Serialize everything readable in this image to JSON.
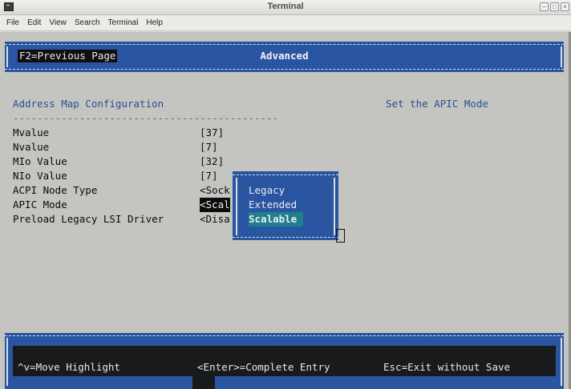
{
  "window": {
    "title": "Terminal",
    "controls": [
      "minimize",
      "maximize",
      "close"
    ]
  },
  "menubar": {
    "items": [
      "File",
      "Edit",
      "View",
      "Search",
      "Terminal",
      "Help"
    ]
  },
  "bios": {
    "header": {
      "f2_label": "F2=Previous Page",
      "title": "Advanced"
    },
    "section_title": "Address Map Configuration",
    "separator": "--------------------------------------------",
    "help_text": "Set the APIC Mode",
    "settings": [
      {
        "name": "Mvalue",
        "value": "[37]"
      },
      {
        "name": "Nvalue",
        "value": "[7]"
      },
      {
        "name": "MIo Value",
        "value": "[32]"
      },
      {
        "name": "NIo Value",
        "value": "[7]"
      },
      {
        "name": "ACPI Node Type",
        "value": "<Sock"
      },
      {
        "name": "APIC Mode",
        "value": "<Scal"
      },
      {
        "name": "Preload Legacy LSI Driver",
        "value": "<Disa"
      }
    ],
    "popup": {
      "options": [
        "Legacy",
        "Extended",
        "Scalable"
      ],
      "selected": "Scalable"
    },
    "footer": {
      "move": "^v=Move Highlight",
      "enter": "<Enter>=Complete Entry",
      "esc": "Esc=Exit without Save"
    }
  },
  "colors": {
    "terminal_bg": "#c4c5c0",
    "bios_blue": "#2a55a0",
    "accent_text": "#2b4e96",
    "selection_teal": "#1f7f8c"
  }
}
